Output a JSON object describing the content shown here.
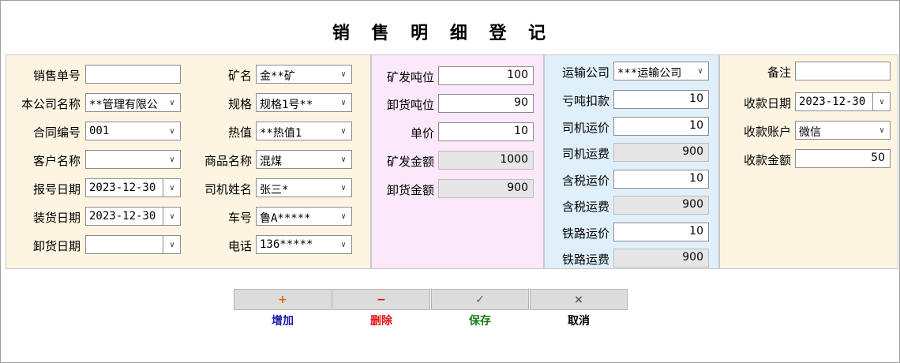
{
  "title": "销 售 明 细 登 记",
  "panel1": {
    "left": [
      {
        "label": "销售单号",
        "value": "",
        "kind": "text"
      },
      {
        "label": "本公司名称",
        "value": "**管理有限公",
        "kind": "combo"
      },
      {
        "label": "合同编号",
        "value": "001",
        "kind": "combo"
      },
      {
        "label": "客户名称",
        "value": "",
        "kind": "combo"
      },
      {
        "label": "报号日期",
        "value": "2023-12-30",
        "kind": "date"
      },
      {
        "label": "装货日期",
        "value": "2023-12-30",
        "kind": "date"
      },
      {
        "label": "卸货日期",
        "value": "",
        "kind": "date"
      }
    ],
    "right": [
      {
        "label": "矿名",
        "value": "金**矿"
      },
      {
        "label": "规格",
        "value": "规格1号**"
      },
      {
        "label": "热值",
        "value": "**热值1"
      },
      {
        "label": "商品名称",
        "value": "混煤"
      },
      {
        "label": "司机姓名",
        "value": "张三*"
      },
      {
        "label": "车号",
        "value": "鲁A*****"
      },
      {
        "label": "电话",
        "value": "136*****"
      }
    ]
  },
  "panel2": [
    {
      "label": "矿发吨位",
      "value": "100",
      "readonly": false
    },
    {
      "label": "卸货吨位",
      "value": "90",
      "readonly": false
    },
    {
      "label": "单价",
      "value": "10",
      "readonly": false
    },
    {
      "label": "矿发金额",
      "value": "1000",
      "readonly": true
    },
    {
      "label": "卸货金额",
      "value": "900",
      "readonly": true
    }
  ],
  "panel3": {
    "transport_label": "运输公司",
    "transport_value": "***运输公司",
    "rows": [
      {
        "label": "亏吨扣款",
        "value": "10",
        "readonly": false
      },
      {
        "label": "司机运价",
        "value": "10",
        "readonly": false
      },
      {
        "label": "司机运费",
        "value": "900",
        "readonly": true
      },
      {
        "label": "含税运价",
        "value": "10",
        "readonly": false
      },
      {
        "label": "含税运费",
        "value": "900",
        "readonly": true
      },
      {
        "label": "铁路运价",
        "value": "10",
        "readonly": false
      },
      {
        "label": "铁路运费",
        "value": "900",
        "readonly": true
      }
    ]
  },
  "panel4": {
    "remark_label": "备注",
    "remark_value": "",
    "date_label": "收款日期",
    "date_value": "2023-12-30",
    "account_label": "收款账户",
    "account_value": "微信",
    "amount_label": "收款金额",
    "amount_value": "50"
  },
  "buttons": [
    {
      "label": "增加",
      "icon": "plus-icon",
      "glyph": "+",
      "label_color": "#1a1aa8",
      "glyph_color": "#e06010"
    },
    {
      "label": "删除",
      "icon": "minus-icon",
      "glyph": "−",
      "label_color": "#e01010",
      "glyph_color": "#e01010"
    },
    {
      "label": "保存",
      "icon": "check-icon",
      "glyph": "✓",
      "label_color": "#1a7a1a",
      "glyph_color": "#606060"
    },
    {
      "label": "取消",
      "icon": "close-icon",
      "glyph": "×",
      "label_color": "#000000",
      "glyph_color": "#606060"
    }
  ]
}
